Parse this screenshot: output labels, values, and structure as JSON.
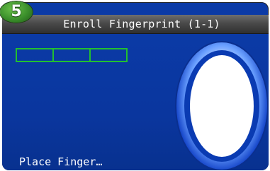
{
  "step_badge": "5",
  "window": {
    "title": "Enroll Fingerprint (1-1)"
  },
  "progress": {
    "segments": 3,
    "filled": 0
  },
  "status_text": "Place Finger…",
  "colors": {
    "background": "#0b3aa6",
    "titlebar": "#4a4a4a",
    "progress_outline": "#22c02f",
    "badge": "#3b8f2b"
  },
  "icons": {
    "fingerprint_area": "fingerprint-oval-icon"
  }
}
